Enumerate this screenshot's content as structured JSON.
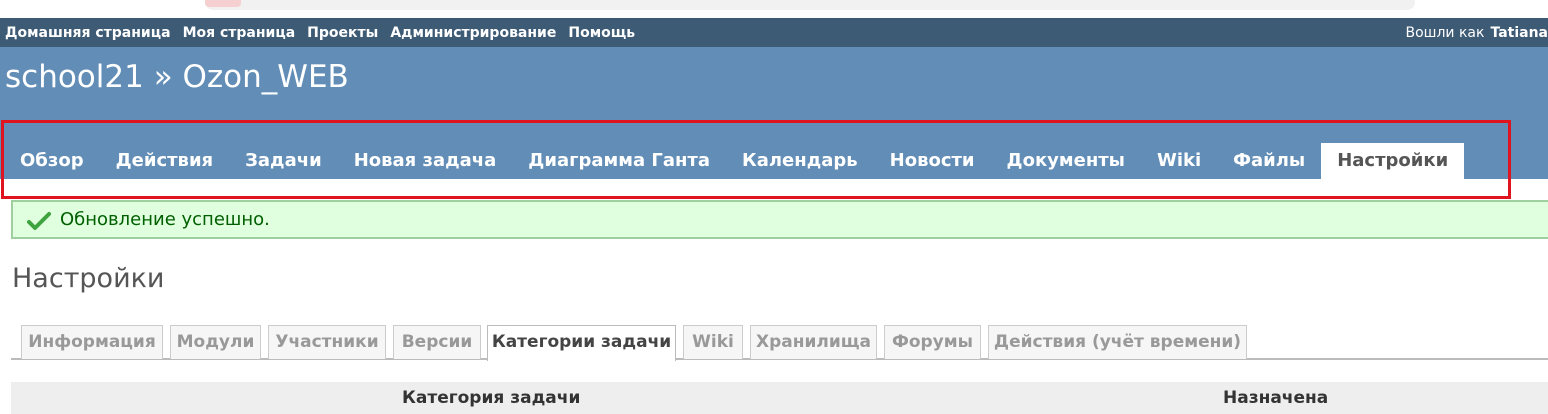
{
  "top_menu": {
    "items": [
      "Домашняя страница",
      "Моя страница",
      "Проекты",
      "Администрирование",
      "Помощь"
    ],
    "logged_as_label": "Вошли как",
    "user": "Tatiana"
  },
  "header": {
    "title": "school21 » Ozon_WEB"
  },
  "main_menu": {
    "tabs": [
      "Обзор",
      "Действия",
      "Задачи",
      "Новая задача",
      "Диаграмма Ганта",
      "Календарь",
      "Новости",
      "Документы",
      "Wiki",
      "Файлы",
      "Настройки"
    ],
    "selected": "Настройки"
  },
  "flash": {
    "icon": "check-icon",
    "message": "Обновление успешно."
  },
  "page": {
    "title": "Настройки"
  },
  "settings_tabs": {
    "tabs": [
      "Информация",
      "Модули",
      "Участники",
      "Версии",
      "Категории задачи",
      "Wiki",
      "Хранилища",
      "Форумы",
      "Действия (учёт времени)"
    ],
    "selected": "Категории задачи"
  },
  "table": {
    "headers": [
      "Категория задачи",
      "Назначена"
    ]
  },
  "colors": {
    "top_menu_bg": "#3e5b76",
    "header_bg": "#628db6",
    "highlight": "#e0141e",
    "flash_bg": "#dfffdf",
    "flash_text": "#005f00"
  }
}
